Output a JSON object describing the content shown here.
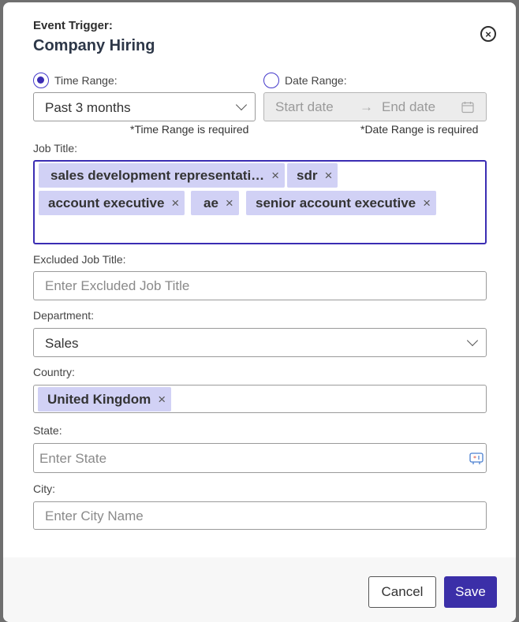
{
  "header": {
    "subtitle": "Event Trigger:",
    "title": "Company Hiring"
  },
  "time_range": {
    "label": "Time Range:",
    "selected": true,
    "value": "Past 3 months",
    "required_note": "*Time Range is required"
  },
  "date_range": {
    "label": "Date Range:",
    "selected": false,
    "start_placeholder": "Start date",
    "end_placeholder": "End date",
    "arrow": "→",
    "required_note": "*Date Range is required"
  },
  "job_title": {
    "label": "Job Title:",
    "tags": [
      "sales development representati…",
      "sdr",
      "account executive",
      "ae",
      "senior account executive"
    ]
  },
  "excluded_job_title": {
    "label": "Excluded Job Title:",
    "placeholder": "Enter Excluded Job Title"
  },
  "department": {
    "label": "Department:",
    "value": "Sales"
  },
  "country": {
    "label": "Country:",
    "tags": [
      "United Kingdom"
    ]
  },
  "state": {
    "label": "State:",
    "placeholder": "Enter State"
  },
  "city": {
    "label": "City:",
    "placeholder": "Enter City Name"
  },
  "footer": {
    "cancel_label": "Cancel",
    "save_label": "Save"
  },
  "icons": {
    "close": "close-circle-icon",
    "calendar": "calendar-icon",
    "tag_remove": "×"
  },
  "colors": {
    "accent": "#3b2fa8",
    "tag_bg": "#d1d1f5"
  }
}
